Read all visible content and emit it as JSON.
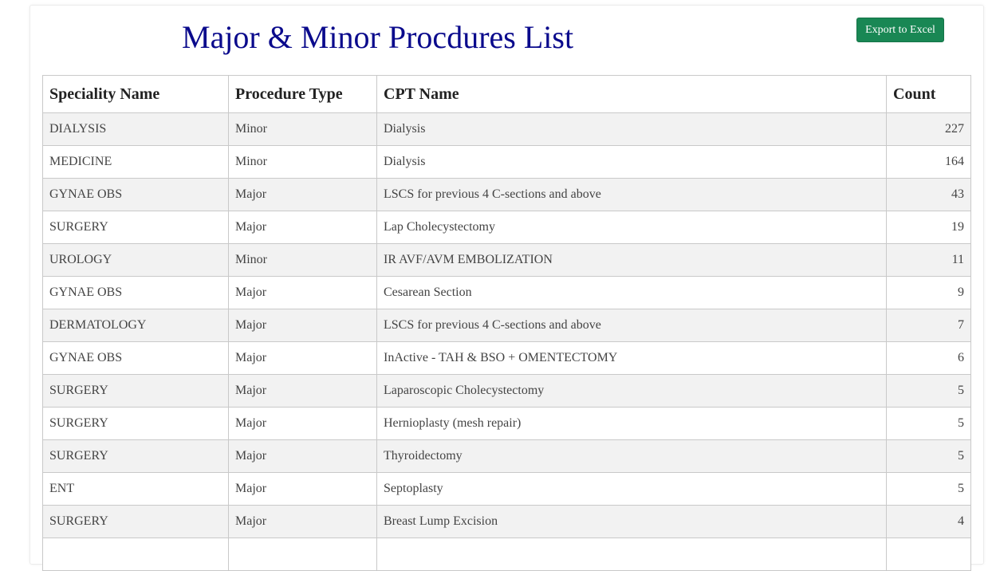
{
  "page": {
    "title": "Major & Minor Procdures List",
    "export_label": "Export to Excel",
    "accent_color": "#198754",
    "title_color": "#0a0a8c"
  },
  "table": {
    "headers": [
      "Speciality Name",
      "Procedure Type",
      "CPT Name",
      "Count"
    ],
    "rows": [
      [
        "DIALYSIS",
        "Minor",
        "Dialysis",
        "227"
      ],
      [
        "MEDICINE",
        "Minor",
        "Dialysis",
        "164"
      ],
      [
        "GYNAE OBS",
        "Major",
        "LSCS for previous 4 C-sections and above",
        "43"
      ],
      [
        "SURGERY",
        "Major",
        "Lap Cholecystectomy",
        "19"
      ],
      [
        "UROLOGY",
        "Minor",
        "IR AVF/AVM EMBOLIZATION",
        "11"
      ],
      [
        "GYNAE OBS",
        "Major",
        "Cesarean Section",
        "9"
      ],
      [
        "DERMATOLOGY",
        "Major",
        "LSCS for previous 4 C-sections and above",
        "7"
      ],
      [
        "GYNAE OBS",
        "Major",
        "InActive - TAH & BSO + OMENTECTOMY",
        "6"
      ],
      [
        "SURGERY",
        "Major",
        "Laparoscopic Cholecystectomy",
        "5"
      ],
      [
        "SURGERY",
        "Major",
        "Hernioplasty (mesh repair)",
        "5"
      ],
      [
        "SURGERY",
        "Major",
        "Thyroidectomy",
        "5"
      ],
      [
        "ENT",
        "Major",
        "Septoplasty",
        "5"
      ],
      [
        "SURGERY",
        "Major",
        "Breast Lump Excision",
        "4"
      ],
      [
        "",
        "",
        "",
        ""
      ]
    ]
  }
}
